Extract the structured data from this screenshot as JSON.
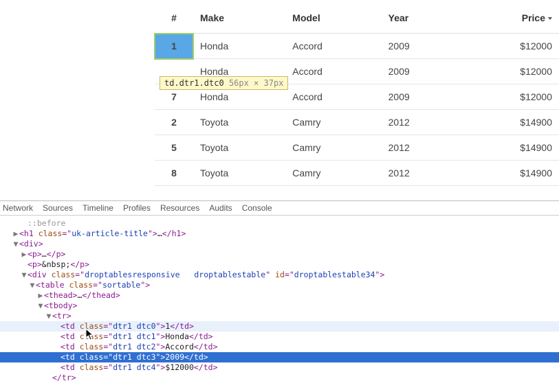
{
  "table": {
    "headers": {
      "num": "#",
      "make": "Make",
      "model": "Model",
      "year": "Year",
      "price": "Price"
    },
    "rows": [
      {
        "num": "1",
        "make": "Honda",
        "model": "Accord",
        "year": "2009",
        "price": "$12000"
      },
      {
        "num": "",
        "make": "Honda",
        "model": "Accord",
        "year": "2009",
        "price": "$12000"
      },
      {
        "num": "7",
        "make": "Honda",
        "model": "Accord",
        "year": "2009",
        "price": "$12000"
      },
      {
        "num": "2",
        "make": "Toyota",
        "model": "Camry",
        "year": "2012",
        "price": "$14900"
      },
      {
        "num": "5",
        "make": "Toyota",
        "model": "Camry",
        "year": "2012",
        "price": "$14900"
      },
      {
        "num": "8",
        "make": "Toyota",
        "model": "Camry",
        "year": "2012",
        "price": "$14900"
      }
    ]
  },
  "tooltip": {
    "selector": "td.dtr1.dtc0",
    "dims": "56px × 37px"
  },
  "devtools": {
    "tabs": [
      "Network",
      "Sources",
      "Timeline",
      "Profiles",
      "Resources",
      "Audits",
      "Console"
    ],
    "lines": {
      "before": "::before",
      "h1_open": "<h1 class=\"uk-article-title\">",
      "h1_ell": "…",
      "h1_close": "</h1>",
      "div_open": "<div>",
      "p_open": "<p>",
      "p_ell": "…",
      "p_close": "</p>",
      "p_nbsp_open": "<p>",
      "p_nbsp_text": "&nbsp;",
      "p_nbsp_close": "</p>",
      "wrap_open": "<div class=\"droptablesresponsive   droptablestable\" id=\"droptablestable34\">",
      "table_open": "<table class=\"sortable\">",
      "thead_open": "<thead>",
      "thead_ell": "…",
      "thead_close": "</thead>",
      "tbody_open": "<tbody>",
      "tr_open": "<tr>",
      "td0_open": "<td class=\"dtr1 dtc0\">",
      "td0_text": "1",
      "td0_close": "</td>",
      "td1_open": "<td class=\"dtr1 dtc1\">",
      "td1_text": "Honda",
      "td1_close": "</td>",
      "td2_open": "<td class=\"dtr1 dtc2\">",
      "td2_text": "Accord",
      "td2_close": "</td>",
      "td3_open": "<td class=\"dtr1 dtc3\">",
      "td3_text": "2009",
      "td3_close": "</td>",
      "td4_open": "<td class=\"dtr1 dtc4\">",
      "td4_text": "$12000",
      "td4_close": "</td>",
      "tr_close": "</tr>"
    }
  }
}
